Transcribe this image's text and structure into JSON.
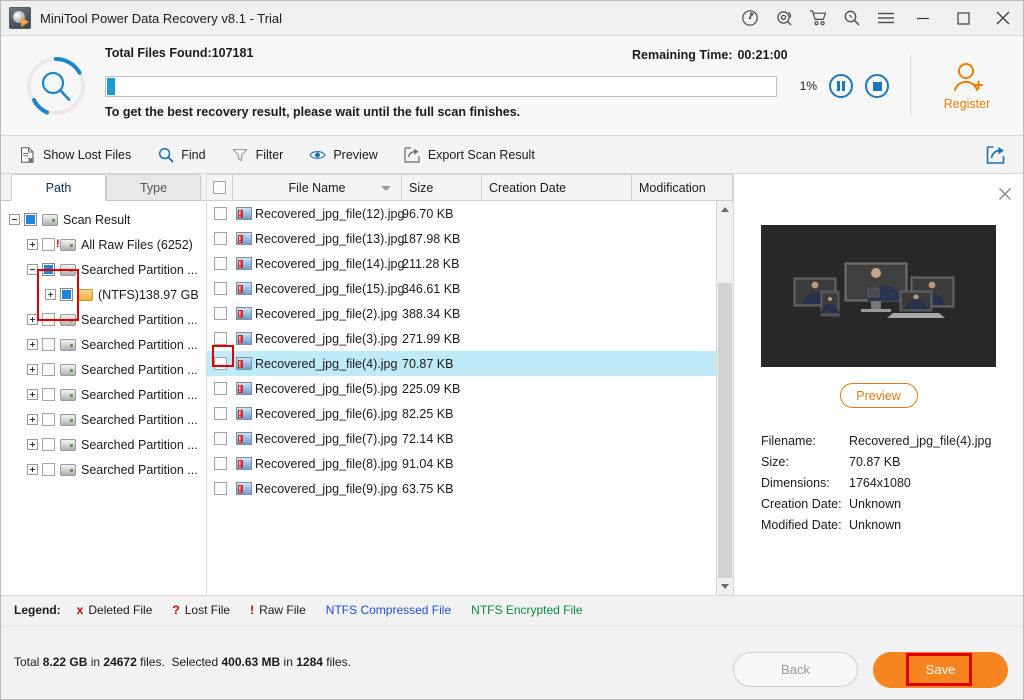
{
  "window": {
    "title": "MiniTool Power Data Recovery v8.1 - Trial",
    "app_icon": "disk-recovery-icon",
    "controls": [
      {
        "name": "disk-scan-icon",
        "label": "Disk Scan"
      },
      {
        "name": "support-icon",
        "label": "Support"
      },
      {
        "name": "cart-icon",
        "label": "Buy Now"
      },
      {
        "name": "search-icon",
        "label": "Search"
      },
      {
        "name": "menu-icon",
        "label": "Menu"
      },
      {
        "name": "minimize-icon",
        "label": "Minimize"
      },
      {
        "name": "maximize-icon",
        "label": "Maximize"
      },
      {
        "name": "close-icon",
        "label": "Close"
      }
    ]
  },
  "scan": {
    "status_icon": "scanning-magnifier-icon",
    "total_files_label": "Total Files Found:",
    "total_files_value": "107181",
    "remaining_time_label": "Remaining Time:",
    "remaining_time_value": "00:21:00",
    "progress_percent": "1%",
    "progress_value": 1,
    "hint": "To get the best recovery result, please wait until the full scan finishes.",
    "pause_label": "Pause",
    "stop_label": "Stop",
    "register_label": "Register",
    "accent_blue": "#1b9bd8",
    "accent_orange": "#ef7d00"
  },
  "toolbar": {
    "items": [
      {
        "icon": "show-lost-files-icon",
        "label": "Show Lost Files"
      },
      {
        "icon": "find-icon",
        "label": "Find"
      },
      {
        "icon": "filter-icon",
        "label": "Filter"
      },
      {
        "icon": "preview-eye-icon",
        "label": "Preview"
      },
      {
        "icon": "export-icon",
        "label": "Export Scan Result"
      }
    ],
    "share_icon": "share-export-icon"
  },
  "tree": {
    "tabs": [
      {
        "label": "Path",
        "active": true
      },
      {
        "label": "Type",
        "active": false
      }
    ],
    "nodes": [
      {
        "label": "Scan Result",
        "indent": 0,
        "expander": "minus",
        "checkbox": "selected",
        "icon": "drive-icon"
      },
      {
        "label": "All Raw Files (6252)",
        "indent": 1,
        "expander": "plus",
        "checkbox": "empty",
        "icon": "raw-drive-icon"
      },
      {
        "label": "Searched Partition ...",
        "indent": 1,
        "expander": "minus",
        "checkbox": "selected",
        "icon": "drive-icon",
        "highlight": true
      },
      {
        "label": "(NTFS)138.97 GB",
        "indent": 2,
        "expander": "plus",
        "checkbox": "selected",
        "icon": "folder-icon",
        "highlight": true
      },
      {
        "label": "Searched Partition ...",
        "indent": 1,
        "expander": "plus",
        "checkbox": "empty",
        "icon": "drive-icon"
      },
      {
        "label": "Searched Partition ...",
        "indent": 1,
        "expander": "plus",
        "checkbox": "empty",
        "icon": "drive-icon"
      },
      {
        "label": "Searched Partition ...",
        "indent": 1,
        "expander": "plus",
        "checkbox": "empty",
        "icon": "drive-icon"
      },
      {
        "label": "Searched Partition ...",
        "indent": 1,
        "expander": "plus",
        "checkbox": "empty",
        "icon": "drive-icon"
      },
      {
        "label": "Searched Partition ...",
        "indent": 1,
        "expander": "plus",
        "checkbox": "empty",
        "icon": "drive-icon"
      },
      {
        "label": "Searched Partition ...",
        "indent": 1,
        "expander": "plus",
        "checkbox": "empty",
        "icon": "drive-icon"
      },
      {
        "label": "Searched Partition ...",
        "indent": 1,
        "expander": "plus",
        "checkbox": "empty",
        "icon": "drive-icon"
      }
    ]
  },
  "filelist": {
    "columns": [
      "File Name",
      "Size",
      "Creation Date",
      "Modification "
    ],
    "sort_column": "File Name",
    "rows": [
      {
        "name": "Recovered_jpg_file(12).jpg",
        "size": "96.70 KB",
        "creation": "",
        "modification": "",
        "selected": false
      },
      {
        "name": "Recovered_jpg_file(13).jpg",
        "size": "187.98 KB",
        "creation": "",
        "modification": "",
        "selected": false
      },
      {
        "name": "Recovered_jpg_file(14).jpg",
        "size": "211.28 KB",
        "creation": "",
        "modification": "",
        "selected": false
      },
      {
        "name": "Recovered_jpg_file(15).jpg",
        "size": "346.61 KB",
        "creation": "",
        "modification": "",
        "selected": false
      },
      {
        "name": "Recovered_jpg_file(2).jpg",
        "size": "388.34 KB",
        "creation": "",
        "modification": "",
        "selected": false
      },
      {
        "name": "Recovered_jpg_file(3).jpg",
        "size": "271.99 KB",
        "creation": "",
        "modification": "",
        "selected": false
      },
      {
        "name": "Recovered_jpg_file(4).jpg",
        "size": "70.87 KB",
        "creation": "",
        "modification": "",
        "selected": true
      },
      {
        "name": "Recovered_jpg_file(5).jpg",
        "size": "225.09 KB",
        "creation": "",
        "modification": "",
        "selected": false
      },
      {
        "name": "Recovered_jpg_file(6).jpg",
        "size": "82.25 KB",
        "creation": "",
        "modification": "",
        "selected": false
      },
      {
        "name": "Recovered_jpg_file(7).jpg",
        "size": "72.14 KB",
        "creation": "",
        "modification": "",
        "selected": false
      },
      {
        "name": "Recovered_jpg_file(8).jpg",
        "size": "91.04 KB",
        "creation": "",
        "modification": "",
        "selected": false
      },
      {
        "name": "Recovered_jpg_file(9).jpg",
        "size": "63.75 KB",
        "creation": "",
        "modification": "",
        "selected": false
      }
    ]
  },
  "preview": {
    "close_icon": "close-icon",
    "thumbnail_alt": "person-in-front-of-monitors-thumbnail",
    "preview_button": "Preview",
    "fields": [
      {
        "key": "Filename:",
        "value": "Recovered_jpg_file(4).jpg"
      },
      {
        "key": "Size:",
        "value": "70.87 KB"
      },
      {
        "key": "Dimensions:",
        "value": "1764x1080"
      },
      {
        "key": "Creation Date:",
        "value": "Unknown"
      },
      {
        "key": "Modified Date:",
        "value": "Unknown"
      }
    ]
  },
  "legend": {
    "title": "Legend:",
    "items": [
      {
        "marker": "x",
        "label": "Deleted File",
        "marker_color": "#cc0000",
        "label_color": "#1b1b1b"
      },
      {
        "marker": "?",
        "label": "Lost File",
        "marker_color": "#cc0000",
        "label_color": "#1b1b1b"
      },
      {
        "marker": "!",
        "label": "Raw File",
        "marker_color": "#cc0000",
        "label_color": "#1b1b1b"
      },
      {
        "marker": "",
        "label": "NTFS Compressed File",
        "marker_color": "",
        "label_color": "#1a4fd6"
      },
      {
        "marker": "",
        "label": "NTFS Encrypted File",
        "marker_color": "",
        "label_color": "#0a8a3c"
      }
    ]
  },
  "footer": {
    "summary": "Total 8.22 GB in 24672 files.  Selected 400.63 MB in 1284 files.",
    "total_size": "8.22 GB",
    "total_files": "24672",
    "selected_size": "400.63 MB",
    "selected_files": "1284",
    "back_label": "Back",
    "save_label": "Save",
    "save_color": "#f7851f"
  }
}
